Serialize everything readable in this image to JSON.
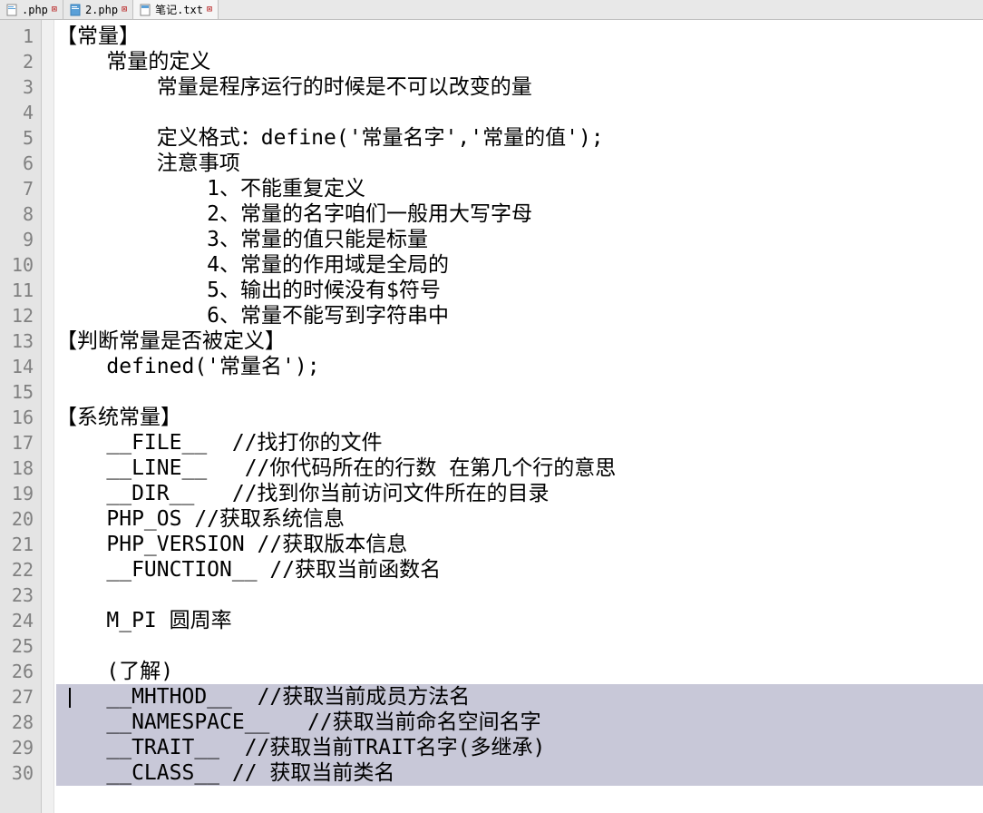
{
  "tabs": [
    {
      "label": ".php",
      "icon": "php",
      "active": false
    },
    {
      "label": "2.php",
      "icon": "php",
      "active": false
    },
    {
      "label": "笔记.txt",
      "icon": "txt",
      "active": true
    }
  ],
  "lineStart": 1,
  "lineEnd": 30,
  "lines": [
    "【常量】",
    "    常量的定义",
    "        常量是程序运行的时候是不可以改变的量",
    "",
    "        定义格式：define('常量名字','常量的值');",
    "        注意事项",
    "            1、不能重复定义",
    "            2、常量的名字咱们一般用大写字母",
    "            3、常量的值只能是标量",
    "            4、常量的作用域是全局的",
    "            5、输出的时候没有$符号",
    "            6、常量不能写到字符串中",
    "【判断常量是否被定义】",
    "    defined('常量名');",
    "",
    "【系统常量】",
    "    __FILE__  //找打你的文件",
    "    __LINE__   //你代码所在的行数 在第几个行的意思",
    "    __DIR__   //找到你当前访问文件所在的目录",
    "    PHP_OS //获取系统信息",
    "    PHP_VERSION //获取版本信息",
    "    __FUNCTION__ //获取当前函数名",
    "",
    "    M_PI 圆周率",
    "",
    "    (了解)",
    "    __MHTHOD__  //获取当前成员方法名",
    "    __NAMESPACE__   //获取当前命名空间名字",
    "    __TRAIT__  //获取当前TRAIT名字(多继承)",
    "    __CLASS__ // 获取当前类名"
  ],
  "selectedLines": [
    27,
    28,
    29,
    30
  ],
  "cursorLine": 27
}
